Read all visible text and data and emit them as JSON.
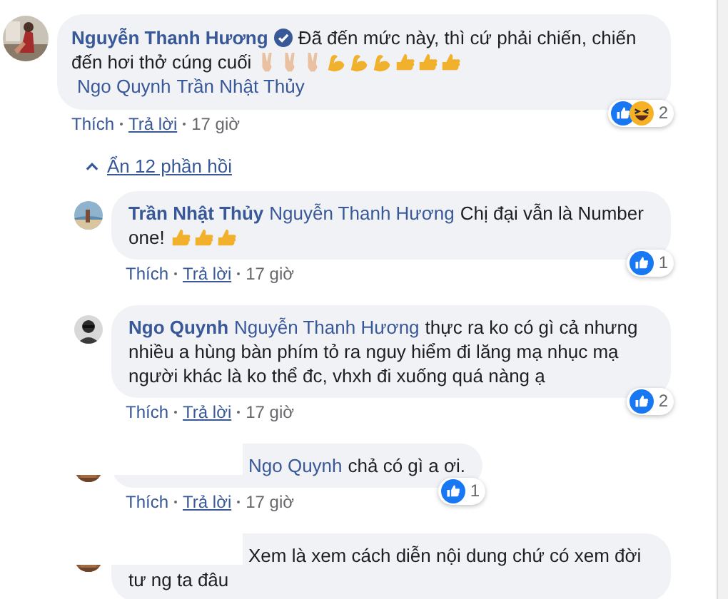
{
  "comment": {
    "author": "Nguyễn Thanh Hương",
    "verified": true,
    "segments": [
      {
        "kind": "text",
        "text": "Đã đến mức này, thì cứ phải chiến, chiến đến hơi thở cúng cuối"
      },
      {
        "kind": "victory"
      },
      {
        "kind": "victory"
      },
      {
        "kind": "victory"
      },
      {
        "kind": "flex"
      },
      {
        "kind": "flex"
      },
      {
        "kind": "flex"
      },
      {
        "kind": "thumb"
      },
      {
        "kind": "thumb"
      },
      {
        "kind": "thumb"
      },
      {
        "kind": "mention",
        "text": "Ngo Quynh"
      },
      {
        "kind": "mention",
        "text": "Trần Nhật Thủy"
      }
    ],
    "actions": [
      {
        "kind": "link",
        "text": "Thích"
      },
      {
        "kind": "link",
        "text": "Trả lời"
      },
      {
        "kind": "time",
        "text": "17 giờ"
      }
    ],
    "reactions": {
      "icons": [
        {
          "kind": "like"
        },
        {
          "kind": "haha"
        }
      ],
      "count": "2"
    }
  },
  "toggle": {
    "label": "Ẩn 12 phần hồi",
    "expanded": true
  },
  "replies": [
    {
      "author": "Trần Nhật Thủy",
      "redacted": false,
      "segments": [
        {
          "kind": "mention",
          "text": "Nguyễn Thanh Hương"
        },
        {
          "kind": "text",
          "text": "Chị đại vẫn là Number one!"
        },
        {
          "kind": "thumb"
        },
        {
          "kind": "thumb"
        },
        {
          "kind": "thumb"
        }
      ],
      "actions": [
        {
          "kind": "link",
          "text": "Thích"
        },
        {
          "kind": "link",
          "text": "Trả lời"
        },
        {
          "kind": "time",
          "text": "17 giờ"
        }
      ],
      "reactions": {
        "icons": [
          {
            "kind": "like"
          }
        ],
        "count": "1"
      }
    },
    {
      "author": "Ngo Quynh",
      "redacted": false,
      "segments": [
        {
          "kind": "mention",
          "text": "Nguyễn Thanh Hương"
        },
        {
          "kind": "text",
          "text": "thực ra ko có gì cả nhưng nhiều a hùng bàn phím tỏ ra nguy hiểm đi lăng mạ nhục mạ người khác là ko thể đc, vhxh đi xuống quá nàng ạ"
        }
      ],
      "actions": [
        {
          "kind": "link",
          "text": "Thích"
        },
        {
          "kind": "link",
          "text": "Trả lời"
        },
        {
          "kind": "time",
          "text": "17 giờ"
        }
      ],
      "reactions": {
        "icons": [
          {
            "kind": "like"
          }
        ],
        "count": "2"
      }
    },
    {
      "redacted": true,
      "segments": [
        {
          "kind": "mention",
          "text": "Ngo Quynh"
        },
        {
          "kind": "text",
          "text": "chả có gì a ơi."
        }
      ],
      "actions": [
        {
          "kind": "link",
          "text": "Thích"
        },
        {
          "kind": "link",
          "text": "Trả lời"
        },
        {
          "kind": "time",
          "text": "17 giờ"
        }
      ],
      "reactions": {
        "icons": [
          {
            "kind": "like"
          }
        ],
        "count": "1"
      }
    },
    {
      "redacted": true,
      "segments": [
        {
          "kind": "text",
          "text": "Xem là xem cách diễn nội dung chứ có xem đời tư ng ta đâu"
        }
      ]
    }
  ]
}
